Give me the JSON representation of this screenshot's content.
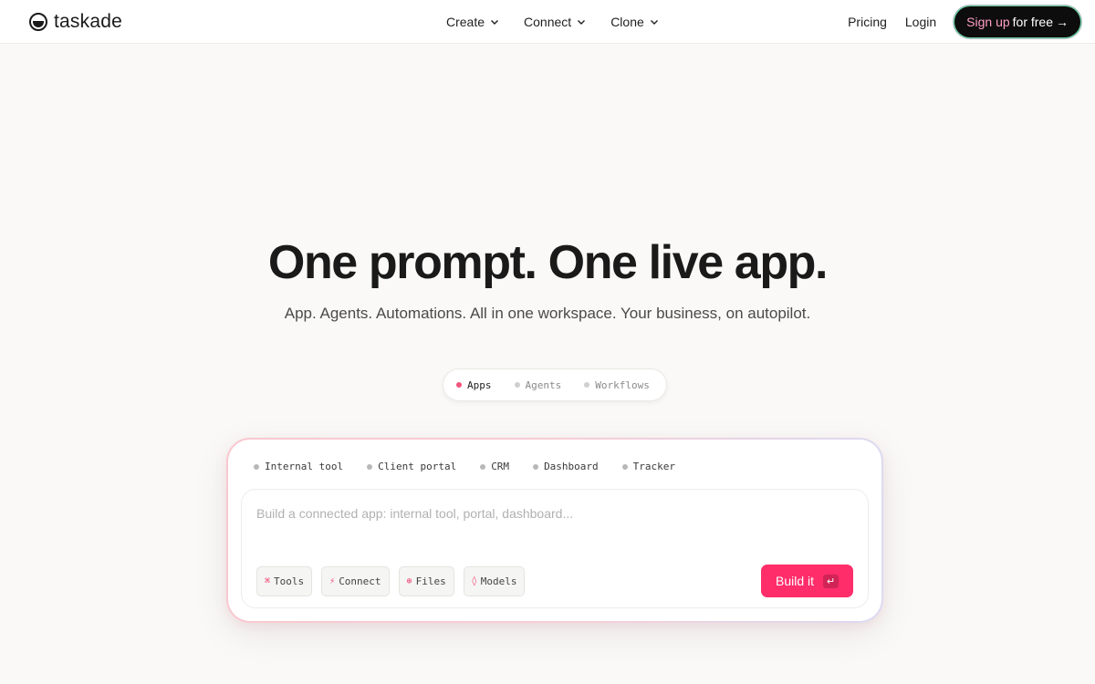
{
  "header": {
    "logo_text": "taskade",
    "nav": [
      {
        "label": "Create",
        "icon": "chevron-down-icon"
      },
      {
        "label": "Connect",
        "icon": "chevron-down-icon"
      },
      {
        "label": "Clone",
        "icon": "chevron-down-icon"
      }
    ],
    "pricing_label": "Pricing",
    "login_label": "Login",
    "signup": {
      "highlight": "Sign up",
      "rest": "for free",
      "arrow": "→"
    }
  },
  "hero": {
    "title": "One prompt. One live app.",
    "subtitle": "App. Agents. Automations. All in one workspace. Your business, on autopilot."
  },
  "modes": [
    {
      "label": "Apps",
      "active": true
    },
    {
      "label": "Agents",
      "active": false
    },
    {
      "label": "Workflows",
      "active": false
    }
  ],
  "prompt": {
    "chips": [
      "Internal tool",
      "Client portal",
      "CRM",
      "Dashboard",
      "Tracker"
    ],
    "placeholder": "Build a connected app: internal tool, portal, dashboard...",
    "tools": [
      {
        "icon": "⌘",
        "label": "Tools"
      },
      {
        "icon": "⚡",
        "label": "Connect"
      },
      {
        "icon": "⊕",
        "label": "Files"
      },
      {
        "icon": "◊",
        "label": "Models"
      }
    ],
    "build_label": "Build it",
    "enter_glyph": "↵"
  },
  "colors": {
    "accent": "#ff2d6a",
    "background": "#faf9f7",
    "signup_bg": "#0d0d0d"
  }
}
